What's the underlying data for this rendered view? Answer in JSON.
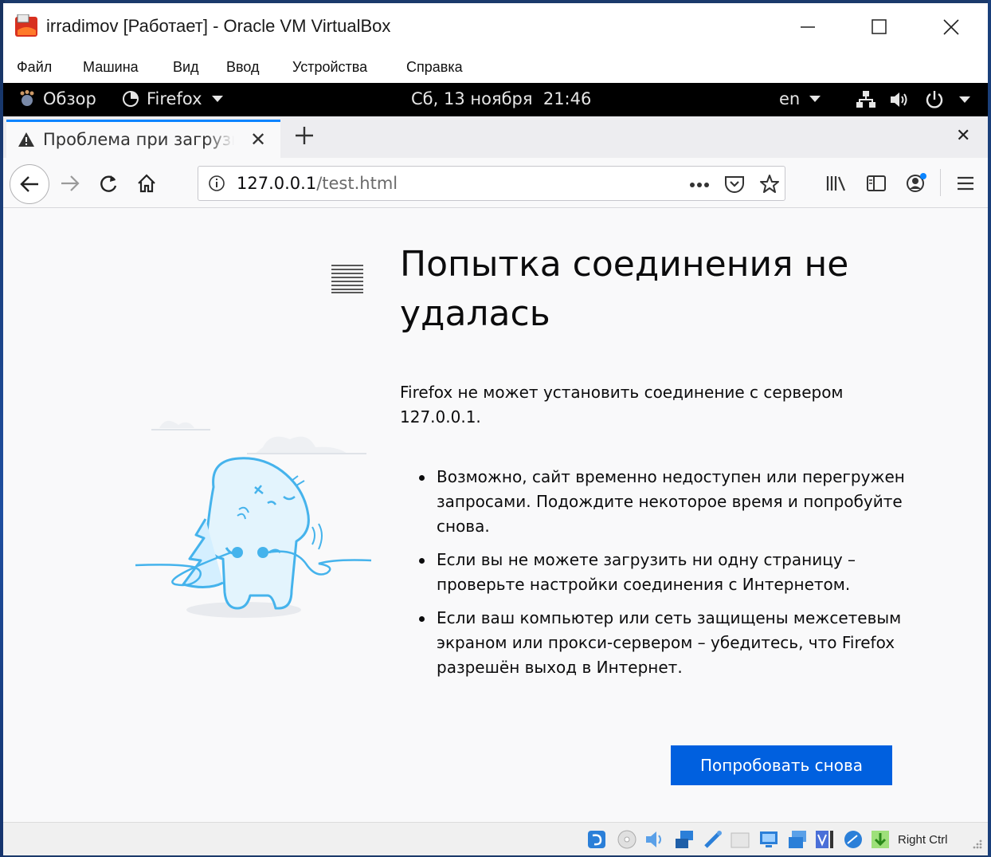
{
  "vbox": {
    "title": "irradimov [Работает] - Oracle VM VirtualBox",
    "menu": [
      "Файл",
      "Машина",
      "Вид",
      "Ввод",
      "Устройства",
      "Справка"
    ],
    "host_key": "Right Ctrl"
  },
  "gnome": {
    "activities": "Обзор",
    "app": "Firefox",
    "clock": "Сб, 13 ноября  21:46",
    "keyboard_layout": "en"
  },
  "firefox": {
    "tab_title": "Проблема при загрузке страницы",
    "url_host": "127.0.0.1",
    "url_path": "/test.html"
  },
  "error_page": {
    "title": "Попытка соединения не удалась",
    "description": "Firefox не может установить соединение с сервером 127.0.0.1.",
    "bullets": [
      "Возможно, сайт временно недоступен или перегружен запросами. Подождите некоторое время и попробуйте снова.",
      "Если вы не можете загрузить ни одну страницу – проверьте настройки соединения с Интернетом.",
      "Если ваш компьютер или сеть защищены межсетевым экраном или прокси-сервером – убедитесь, что Firefox разрешён выход в Интернет."
    ],
    "retry_label": "Попробовать снова"
  },
  "colors": {
    "accent": "#0060df",
    "tab_highlight": "#0a84ff",
    "gnome_bar": "#000000",
    "content_bg": "#f9f9fa"
  }
}
